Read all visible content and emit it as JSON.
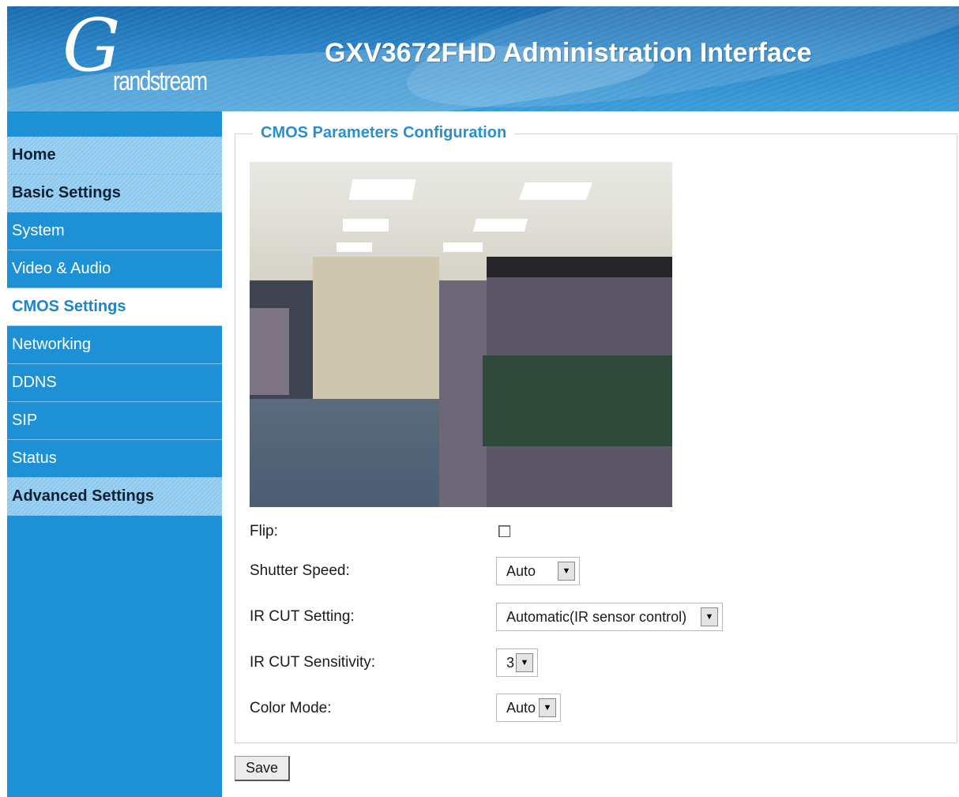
{
  "header": {
    "logo_initial": "G",
    "logo_word": "randstream",
    "title": "GXV3672FHD Administration Interface"
  },
  "sidebar": {
    "items": [
      {
        "label": "Home"
      },
      {
        "label": "Basic Settings"
      },
      {
        "label": "System"
      },
      {
        "label": "Video & Audio"
      },
      {
        "label": "CMOS Settings"
      },
      {
        "label": "Networking"
      },
      {
        "label": "DDNS"
      },
      {
        "label": "SIP"
      },
      {
        "label": "Status"
      },
      {
        "label": "Advanced Settings"
      }
    ]
  },
  "main": {
    "legend": "CMOS Parameters Configuration",
    "flip_label": "Flip:",
    "shutter_label": "Shutter Speed:",
    "shutter_value": "Auto",
    "ircut_label": "IR CUT Setting:",
    "ircut_value": "Automatic(IR sensor control)",
    "ircut_sens_label": "IR CUT Sensitivity:",
    "ircut_sens_value": "3",
    "color_label": "Color Mode:",
    "color_value": "Auto",
    "save_label": "Save"
  }
}
